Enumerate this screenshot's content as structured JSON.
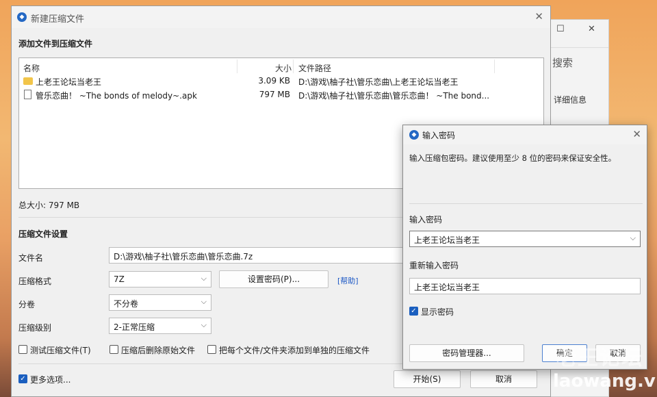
{
  "main_window": {
    "title": "新建压缩文件",
    "add_section_title": "添加文件到压缩文件",
    "columns": [
      "名称",
      "大小",
      "文件路径"
    ],
    "files": [
      {
        "type": "folder",
        "name": "上老王论坛当老王",
        "size": "3.09 KB",
        "path": "D:\\游戏\\柚子社\\管乐恋曲\\上老王论坛当老王"
      },
      {
        "type": "file",
        "name": "管乐恋曲！ ~The bonds of melody~.apk",
        "size": "797 MB",
        "path": "D:\\游戏\\柚子社\\管乐恋曲\\管乐恋曲！ ~The bond..."
      }
    ],
    "total_size": "总大小: 797 MB",
    "settings_title": "压缩文件设置",
    "filename_label": "文件名",
    "filename_value": "D:\\游戏\\柚子社\\管乐恋曲\\管乐恋曲.7z",
    "format_label": "压缩格式",
    "format_value": "7Z",
    "set_password_button": "设置密码(P)...",
    "help_link": "[帮助]",
    "split_label": "分卷",
    "split_value": "不分卷",
    "level_label": "压缩级别",
    "level_value": "2-正常压缩",
    "options": [
      {
        "label": "测试压缩文件(T)",
        "checked": false
      },
      {
        "label": "压缩后删除原始文件",
        "checked": false
      },
      {
        "label": "把每个文件/文件夹添加到单独的压缩文件",
        "checked": false
      }
    ],
    "more_options": {
      "label": "更多选项...",
      "checked": true
    },
    "start_button": "开始(S)",
    "cancel_button": "取消"
  },
  "background_window": {
    "search_text": "搜索",
    "detail_text": "详细信息"
  },
  "password_dialog": {
    "title": "输入密码",
    "description": "输入压缩包密码。建议使用至少 8 位的密码来保证安全性。",
    "password_label": "输入密码",
    "password_value": "上老王论坛当老王",
    "reenter_label": "重新输入密码",
    "reenter_value": "上老王论坛当老王",
    "show_password": {
      "label": "显示密码",
      "checked": true
    },
    "manager_button": "密码管理器...",
    "ok_button": "确定",
    "cancel_button": "取消"
  },
  "watermark": {
    "cn": "老王论坛",
    "en": "laowang.vip"
  },
  "icons": {
    "checkmark": "✓",
    "chevron": "⌵",
    "close": "✕",
    "maximize": "☐",
    "app": "⌂"
  }
}
